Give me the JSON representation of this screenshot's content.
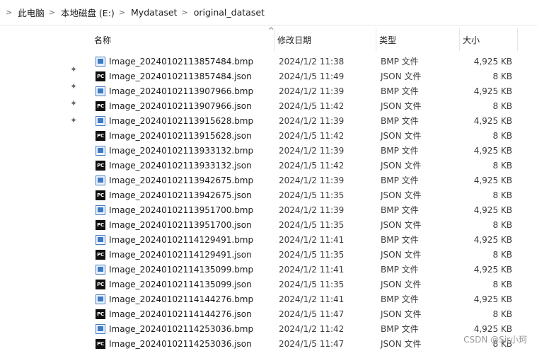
{
  "breadcrumb": {
    "items": [
      "此电脑",
      "本地磁盘 (E:)",
      "Mydataset",
      "original_dataset"
    ]
  },
  "columns": {
    "name": "名称",
    "date": "修改日期",
    "type": "类型",
    "size": "大小"
  },
  "files": [
    {
      "name": "Image_20240102113857484.bmp",
      "date": "2024/1/2 11:38",
      "type": "BMP 文件",
      "size": "4,925 KB",
      "icon": "bmp-file-icon"
    },
    {
      "name": "Image_20240102113857484.json",
      "date": "2024/1/5 11:49",
      "type": "JSON 文件",
      "size": "8 KB",
      "icon": "json-file-icon"
    },
    {
      "name": "Image_20240102113907966.bmp",
      "date": "2024/1/2 11:39",
      "type": "BMP 文件",
      "size": "4,925 KB",
      "icon": "bmp-file-icon"
    },
    {
      "name": "Image_20240102113907966.json",
      "date": "2024/1/5 11:42",
      "type": "JSON 文件",
      "size": "8 KB",
      "icon": "json-file-icon"
    },
    {
      "name": "Image_20240102113915628.bmp",
      "date": "2024/1/2 11:39",
      "type": "BMP 文件",
      "size": "4,925 KB",
      "icon": "bmp-file-icon"
    },
    {
      "name": "Image_20240102113915628.json",
      "date": "2024/1/5 11:42",
      "type": "JSON 文件",
      "size": "8 KB",
      "icon": "json-file-icon"
    },
    {
      "name": "Image_20240102113933132.bmp",
      "date": "2024/1/2 11:39",
      "type": "BMP 文件",
      "size": "4,925 KB",
      "icon": "bmp-file-icon"
    },
    {
      "name": "Image_20240102113933132.json",
      "date": "2024/1/5 11:42",
      "type": "JSON 文件",
      "size": "8 KB",
      "icon": "json-file-icon"
    },
    {
      "name": "Image_20240102113942675.bmp",
      "date": "2024/1/2 11:39",
      "type": "BMP 文件",
      "size": "4,925 KB",
      "icon": "bmp-file-icon"
    },
    {
      "name": "Image_20240102113942675.json",
      "date": "2024/1/5 11:35",
      "type": "JSON 文件",
      "size": "8 KB",
      "icon": "json-file-icon"
    },
    {
      "name": "Image_20240102113951700.bmp",
      "date": "2024/1/2 11:39",
      "type": "BMP 文件",
      "size": "4,925 KB",
      "icon": "bmp-file-icon"
    },
    {
      "name": "Image_20240102113951700.json",
      "date": "2024/1/5 11:35",
      "type": "JSON 文件",
      "size": "8 KB",
      "icon": "json-file-icon"
    },
    {
      "name": "Image_20240102114129491.bmp",
      "date": "2024/1/2 11:41",
      "type": "BMP 文件",
      "size": "4,925 KB",
      "icon": "bmp-file-icon"
    },
    {
      "name": "Image_20240102114129491.json",
      "date": "2024/1/5 11:35",
      "type": "JSON 文件",
      "size": "8 KB",
      "icon": "json-file-icon"
    },
    {
      "name": "Image_20240102114135099.bmp",
      "date": "2024/1/2 11:41",
      "type": "BMP 文件",
      "size": "4,925 KB",
      "icon": "bmp-file-icon"
    },
    {
      "name": "Image_20240102114135099.json",
      "date": "2024/1/5 11:35",
      "type": "JSON 文件",
      "size": "8 KB",
      "icon": "json-file-icon"
    },
    {
      "name": "Image_20240102114144276.bmp",
      "date": "2024/1/2 11:41",
      "type": "BMP 文件",
      "size": "4,925 KB",
      "icon": "bmp-file-icon"
    },
    {
      "name": "Image_20240102114144276.json",
      "date": "2024/1/5 11:47",
      "type": "JSON 文件",
      "size": "8 KB",
      "icon": "json-file-icon"
    },
    {
      "name": "Image_20240102114253036.bmp",
      "date": "2024/1/2 11:42",
      "type": "BMP 文件",
      "size": "4,925 KB",
      "icon": "bmp-file-icon"
    },
    {
      "name": "Image_20240102114253036.json",
      "date": "2024/1/5 11:47",
      "type": "JSON 文件",
      "size": "8 KB",
      "icon": "json-file-icon"
    }
  ],
  "pins": [
    "pin-icon",
    "pin-icon",
    "pin-icon",
    "pin-icon"
  ],
  "json_icon_text": "PC",
  "watermark": "CSDN @Sir小珂",
  "colors": {
    "bmp_icon": "#3d79c7",
    "json_icon": "#111111",
    "header_divider": "#e5e5e5"
  }
}
